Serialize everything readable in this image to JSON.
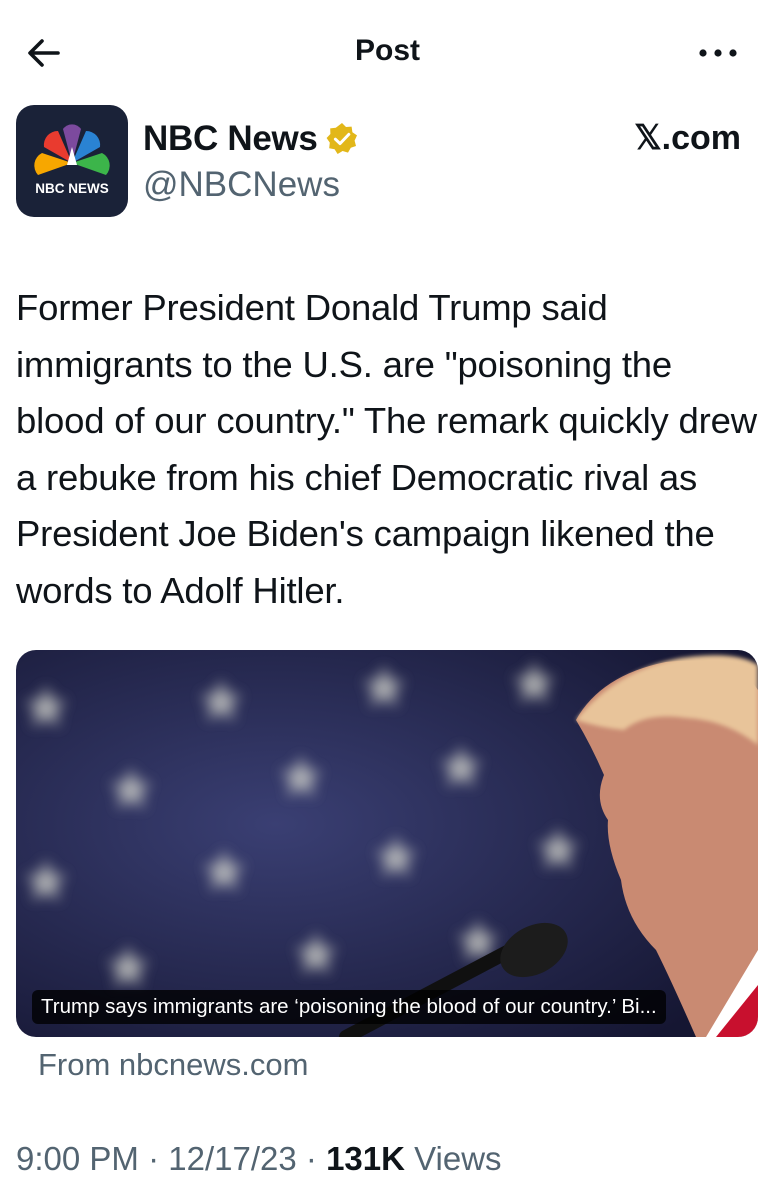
{
  "header": {
    "title": "Post",
    "back_icon": "arrow-left-icon",
    "more_icon": "more-horizontal-icon"
  },
  "author": {
    "display_name": "NBC News",
    "handle": "@NBCNews",
    "verified": true,
    "verified_color": "#e2b719",
    "avatar_text": "NBC NEWS",
    "avatar_bg": "#1a2238"
  },
  "source_label": "𝕏.com",
  "post": {
    "text": "Former President Donald Trump said immigrants to the U.S. are \"poisoning the blood of our country.\" The remark quickly drew a rebuke from his chief Democratic rival as President Joe Biden's campaign likened the words to Adolf Hitler."
  },
  "link_card": {
    "caption": "Trump says immigrants are ‘poisoning the blood of our country.’ Bi...",
    "source": "From nbcnews.com"
  },
  "meta": {
    "time": "9:00 PM",
    "separator": "·",
    "date": "12/17/23",
    "views_count": "131K",
    "views_label": "Views"
  },
  "colors": {
    "text": "#0f1419",
    "secondary": "#536471",
    "background": "#ffffff"
  }
}
